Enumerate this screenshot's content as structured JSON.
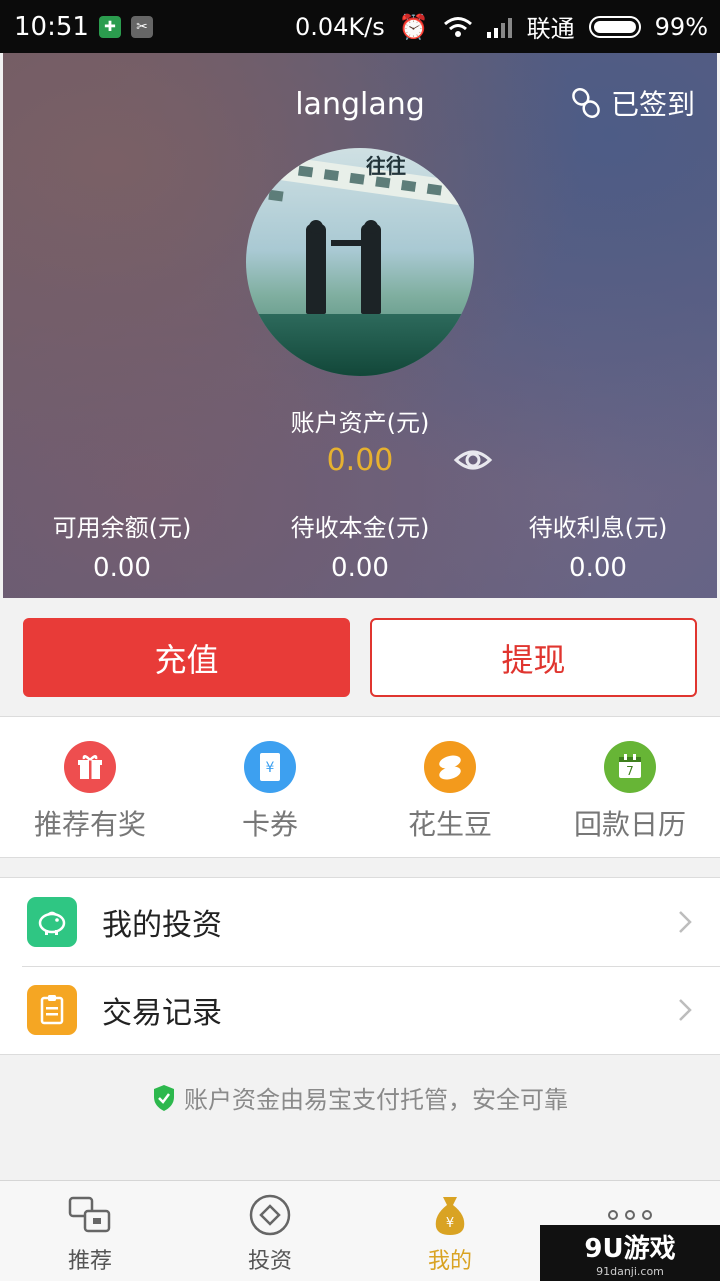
{
  "status_bar": {
    "time": "10:51",
    "network_speed": "0.04K/s",
    "carrier": "联通",
    "battery": "99%"
  },
  "header": {
    "username": "langlang",
    "sign_in_status": "已签到",
    "avatar_text": "往往",
    "assets_label": "账户资产(元)",
    "assets_value": "0.00",
    "stats": [
      {
        "title": "可用余额(元)",
        "value": "0.00"
      },
      {
        "title": "待收本金(元)",
        "value": "0.00"
      },
      {
        "title": "待收利息(元)",
        "value": "0.00"
      }
    ]
  },
  "buttons": {
    "recharge": "充值",
    "withdraw": "提现"
  },
  "quick_menu": [
    {
      "label": "推荐有奖",
      "icon": "gift-icon",
      "color": "#ee4e4f"
    },
    {
      "label": "卡券",
      "icon": "coupon-icon",
      "color": "#3da0f0"
    },
    {
      "label": "花生豆",
      "icon": "peanut-icon",
      "color": "#f39a1c"
    },
    {
      "label": "回款日历",
      "icon": "calendar-icon",
      "color": "#67b536",
      "day": "7"
    }
  ],
  "list": [
    {
      "label": "我的投资",
      "icon": "piggy-bank-icon",
      "color": "#2fc683"
    },
    {
      "label": "交易记录",
      "icon": "clipboard-icon",
      "color": "#f5a623"
    }
  ],
  "security_note": "账户资金由易宝支付托管，安全可靠",
  "tab_bar": [
    {
      "label": "推荐",
      "icon": "recommend-icon"
    },
    {
      "label": "投资",
      "icon": "invest-icon"
    },
    {
      "label": "我的",
      "icon": "money-bag-icon",
      "active": true
    },
    {
      "label": "",
      "icon": "more-icon"
    }
  ],
  "watermark": {
    "brand": "9U游戏",
    "site": "91danji.com"
  },
  "colors": {
    "accent": "#e83b38",
    "gold": "#e6b12f",
    "active_tab": "#d9a323"
  }
}
